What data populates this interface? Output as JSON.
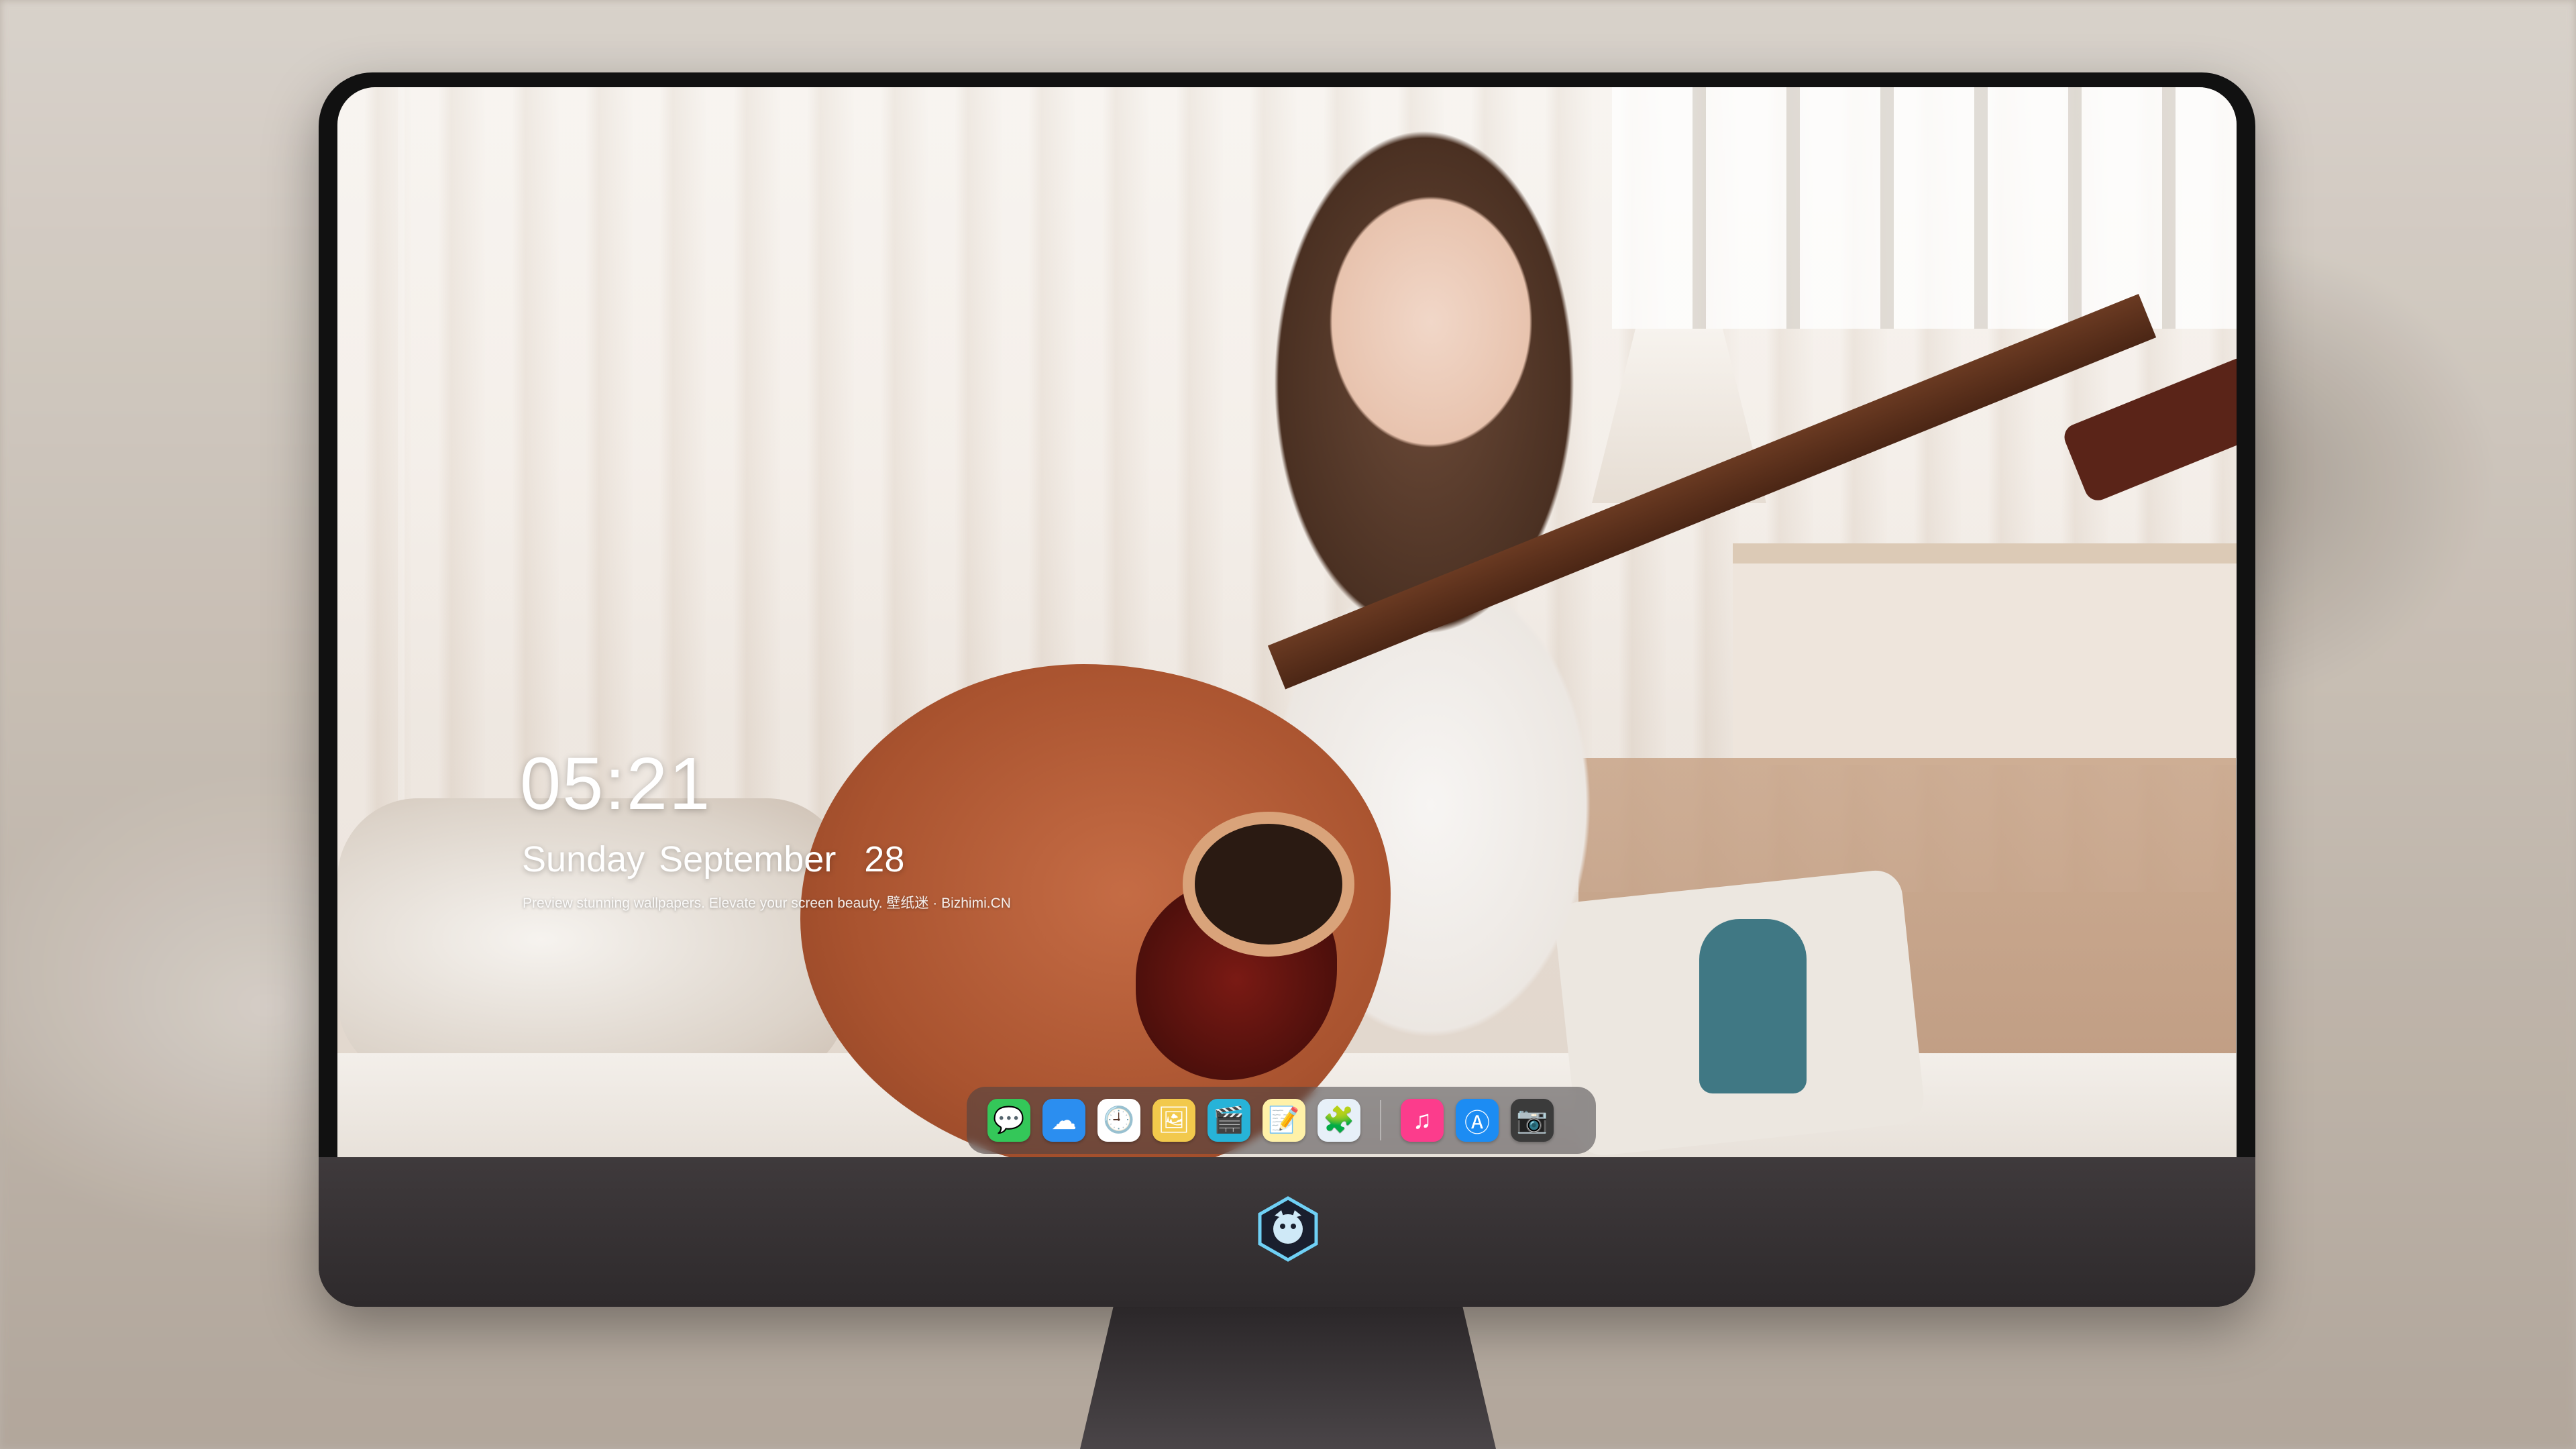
{
  "lockscreen": {
    "time": "05:21",
    "date": "Sunday September  28",
    "caption": "Preview stunning wallpapers. Elevate your screen beauty. 壁纸迷 · Bizhimi.CN"
  },
  "dock": {
    "apps": [
      {
        "name": "messages-icon",
        "glyph": "💬",
        "color": "#34c759"
      },
      {
        "name": "weather-icon",
        "glyph": "☁",
        "color": "#2b8ef0"
      },
      {
        "name": "clock-icon",
        "glyph": "🕘",
        "color": "#ffffff"
      },
      {
        "name": "preview-icon",
        "glyph": "🖼",
        "color": "#f2c94c"
      },
      {
        "name": "clips-icon",
        "glyph": "🎬",
        "color": "#27b3d8"
      },
      {
        "name": "notes-icon",
        "glyph": "📝",
        "color": "#fff1a8"
      },
      {
        "name": "photo-booth-icon",
        "glyph": "🧩",
        "color": "#e7f0f8"
      },
      {
        "name": "music-icon",
        "glyph": "♫",
        "color": "#fc3c8c"
      },
      {
        "name": "app-store-icon",
        "glyph": "Ⓐ",
        "color": "#1c8cf3"
      },
      {
        "name": "camera-icon",
        "glyph": "📷",
        "color": "#3b3b3b"
      }
    ]
  },
  "colors": {
    "bezel": "#111111",
    "chin": "#3a3537",
    "dock_bg": "rgba(70,65,70,0.55)"
  }
}
